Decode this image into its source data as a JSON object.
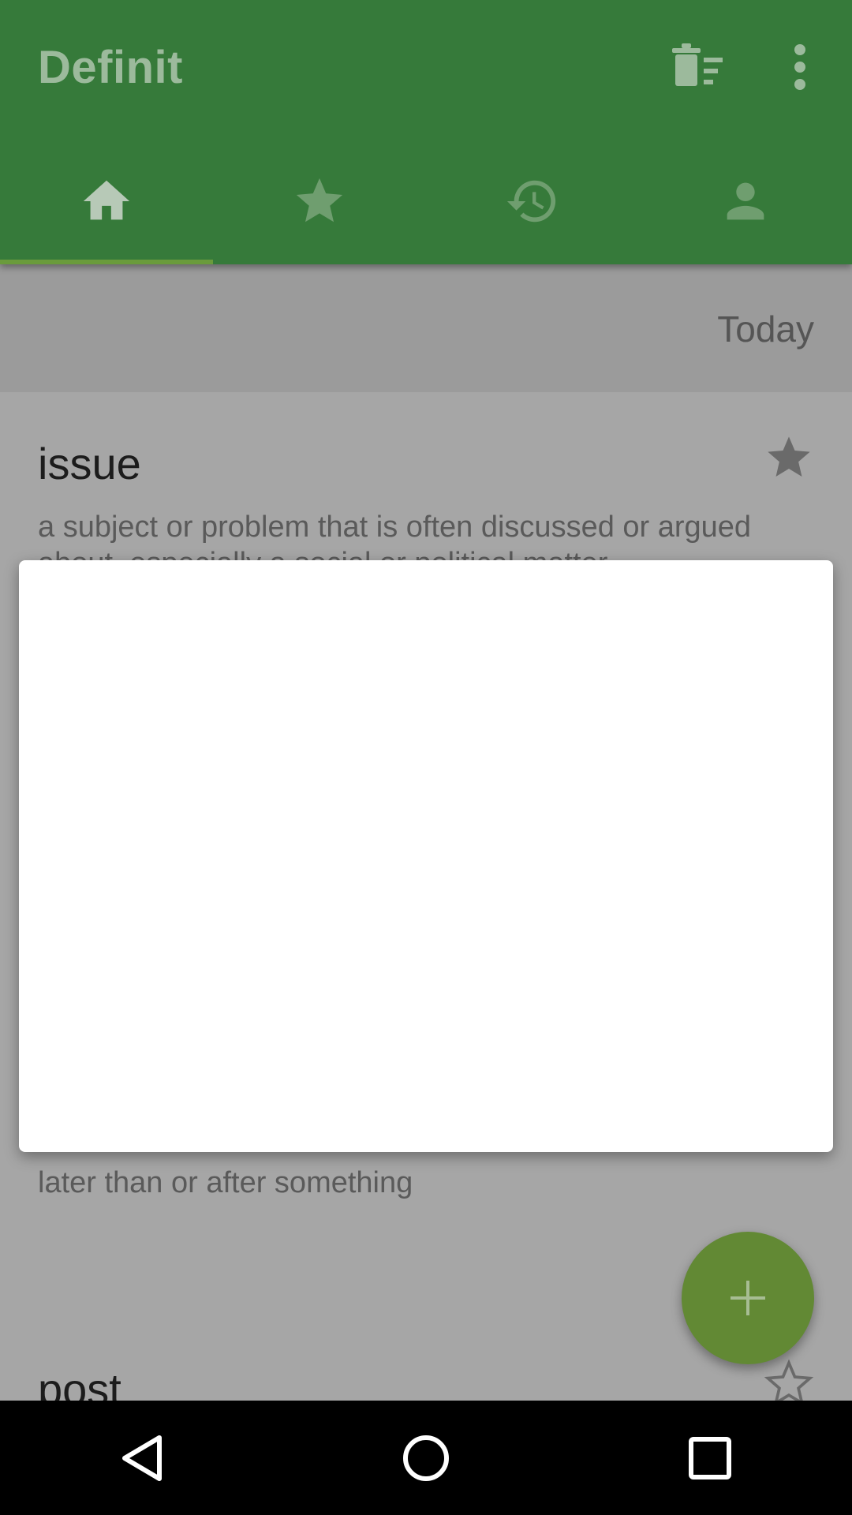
{
  "app": {
    "title": "Definit"
  },
  "toolbar": {
    "delete_icon": "delete-sweep-icon",
    "more_icon": "more-vert-icon"
  },
  "tabs": [
    {
      "name": "home",
      "icon": "home-icon",
      "selected": true
    },
    {
      "name": "favorites",
      "icon": "star-icon",
      "selected": false
    },
    {
      "name": "history",
      "icon": "history-icon",
      "selected": false
    },
    {
      "name": "profile",
      "icon": "person-icon",
      "selected": false
    }
  ],
  "list": {
    "section_label": "Today",
    "entries": [
      {
        "word": "issue",
        "definition": "a subject or problem that is often discussed or argued about, especially a social or political matter",
        "starred": true
      },
      {
        "word": "",
        "definition": "later than or after something",
        "starred": false
      },
      {
        "word": "post",
        "definition": "",
        "starred": false
      }
    ]
  },
  "fab": {
    "icon": "plus-icon"
  },
  "navbar": {
    "back_icon": "back-icon",
    "home_icon": "home-circle-icon",
    "recents_icon": "recents-icon"
  },
  "colors": {
    "appbar": "#367a3a",
    "accent": "#628934",
    "scrim": "#a6a6a6"
  }
}
